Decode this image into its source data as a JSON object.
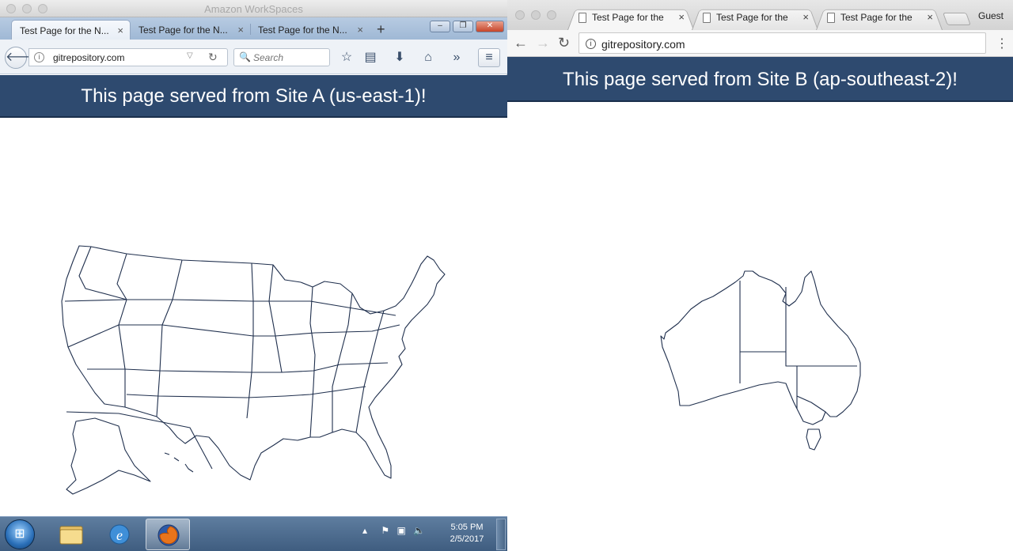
{
  "workspaces": {
    "window_title": "Amazon WorkSpaces",
    "firefox": {
      "tabs": [
        {
          "label": "Test Page for the N..."
        },
        {
          "label": "Test Page for the N..."
        },
        {
          "label": "Test Page for the N..."
        }
      ],
      "close_glyph": "×",
      "new_tab_glyph": "+",
      "url": "gitrepository.com",
      "search_placeholder": "Search"
    },
    "page": {
      "heading": "This page served from Site A (us-east-1)!"
    },
    "taskbar": {
      "time": "5:05 PM",
      "date": "2/5/2017"
    }
  },
  "chrome": {
    "tabs": [
      {
        "label": "Test Page for the"
      },
      {
        "label": "Test Page for the"
      },
      {
        "label": "Test Page for the"
      }
    ],
    "close_glyph": "×",
    "profile": "Guest",
    "url": "gitrepository.com",
    "page": {
      "heading": "This page served from Site B (ap-southeast-2)!"
    }
  },
  "colors": {
    "header_bg": "#2e4a6f",
    "map_stroke": "#1f2f4d"
  },
  "icons": {
    "back": "arrow-left-icon",
    "info": "info-icon",
    "reload": "reload-icon",
    "search": "magnifier-icon",
    "bookmark": "star-icon",
    "reading_list": "clipboard-icon",
    "download": "download-icon",
    "home": "home-icon",
    "overflow": "double-chevron-icon",
    "menu": "hamburger-icon"
  }
}
